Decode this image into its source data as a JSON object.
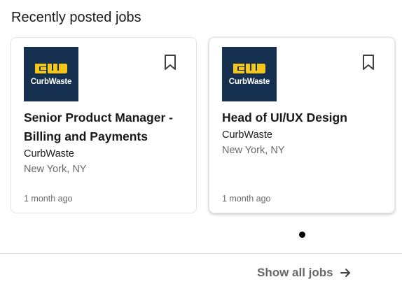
{
  "section": {
    "title": "Recently posted jobs"
  },
  "jobs": [
    {
      "logo_text": "CurbWaste",
      "title": "Senior Product Manager - Billing and Payments",
      "company": "CurbWaste",
      "location": "New York, NY",
      "posted": "1 month ago"
    },
    {
      "logo_text": "CurbWaste",
      "title": "Head of UI/UX Design",
      "company": "CurbWaste",
      "location": "New York, NY",
      "posted": "1 month ago"
    }
  ],
  "footer": {
    "show_all_label": "Show all jobs"
  },
  "icons": {
    "bookmark": "bookmark-icon",
    "arrow": "arrow-right-icon"
  },
  "colors": {
    "logo_background": "#15314f",
    "logo_mark": "#f5c518",
    "pager_active": "#000000"
  }
}
